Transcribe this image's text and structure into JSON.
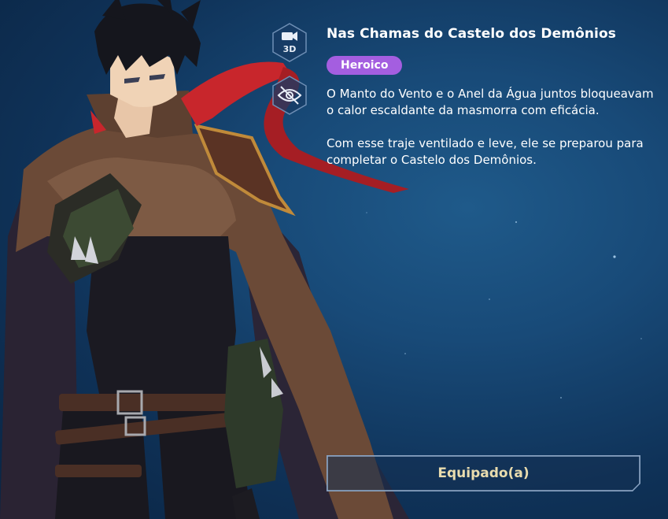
{
  "skin": {
    "title": "Nas Chamas do Castelo dos Demônios",
    "rarity": "Heroico",
    "description": [
      "O Manto do Vento e o Anel da Água juntos bloqueavam o calor escaldante da masmorra com eficácia.",
      "Com esse traje ventilado e leve, ele se preparou para completar o Castelo dos Demônios."
    ]
  },
  "controls": {
    "view_3d_label": "3D",
    "view_3d_icon": "video-camera-icon",
    "hide_ui_icon": "eye-slash-icon"
  },
  "action": {
    "equipped_label": "Equipado(a)"
  },
  "colors": {
    "background": "#184a78",
    "rarity_badge": "#a45ee0",
    "equipped_text": "#e9dcae",
    "scarf": "#c8262c"
  }
}
